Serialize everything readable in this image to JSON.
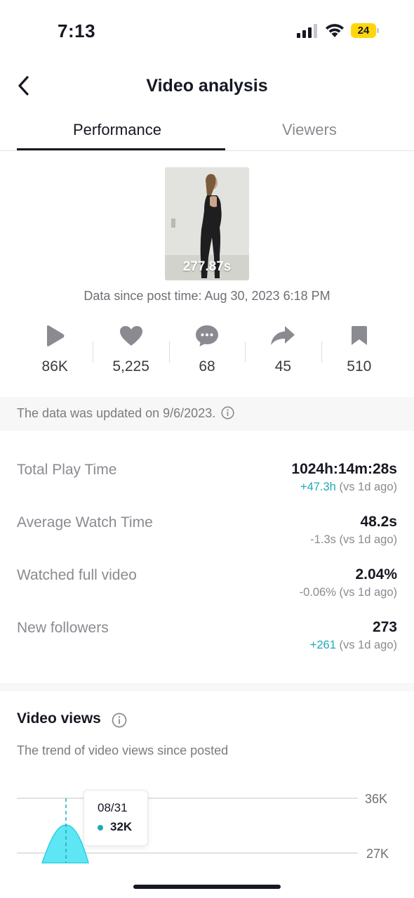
{
  "status": {
    "time": "7:13",
    "battery": "24"
  },
  "nav": {
    "title": "Video analysis"
  },
  "tabs": [
    {
      "label": "Performance",
      "active": true
    },
    {
      "label": "Viewers",
      "active": false
    }
  ],
  "video": {
    "duration": "277.87s",
    "since": "Data since post time: Aug 30, 2023 6:18 PM"
  },
  "stats": [
    {
      "icon": "play-icon",
      "value": "86K"
    },
    {
      "icon": "heart-icon",
      "value": "5,225"
    },
    {
      "icon": "comment-icon",
      "value": "68"
    },
    {
      "icon": "share-icon",
      "value": "45"
    },
    {
      "icon": "bookmark-icon",
      "value": "510"
    }
  ],
  "updated_text": "The data was updated on 9/6/2023.",
  "metrics": [
    {
      "label": "Total Play Time",
      "value": "1024h:14m:28s",
      "delta": "+47.3h",
      "delta_suffix": " (vs 1d ago)"
    },
    {
      "label": "Average Watch Time",
      "value": "48.2s",
      "delta": "-1.3s",
      "delta_suffix": " (vs 1d ago)"
    },
    {
      "label": "Watched full video",
      "value": "2.04%",
      "delta": "-0.06%",
      "delta_suffix": " (vs 1d ago)"
    },
    {
      "label": "New followers",
      "value": "273",
      "delta": "+261",
      "delta_suffix": " (vs 1d ago)"
    }
  ],
  "video_views": {
    "title": "Video views",
    "subtitle": "The trend of video views since posted",
    "y_ticks": [
      "36K",
      "27K"
    ],
    "tooltip": {
      "date": "08/31",
      "value": "32K"
    }
  },
  "colors": {
    "accent": "#20a9b7",
    "area_fill": "#5ee6f5",
    "text": "#161823",
    "muted": "#8a8b91"
  }
}
